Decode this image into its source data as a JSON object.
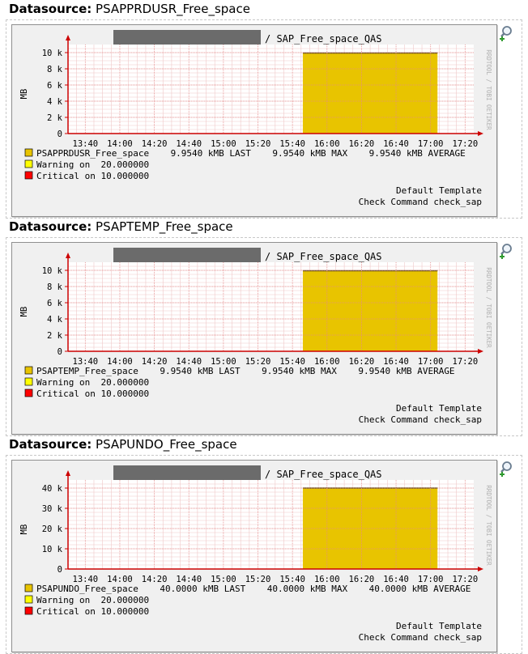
{
  "sections": [
    {
      "heading_label": "Datasource:",
      "name": "PSAPPRDUSR_Free_space",
      "graph_title_suffix": "/ SAP_Free_space_QAS",
      "ylabel": "MB",
      "y_ticks": [
        "0",
        "2 k",
        "4 k",
        "6 k",
        "8 k",
        "10 k"
      ],
      "x_ticks": [
        "13:40",
        "14:00",
        "14:20",
        "14:40",
        "15:00",
        "15:20",
        "15:40",
        "16:00",
        "16:20",
        "16:40",
        "17:00",
        "17:20"
      ],
      "side_text": "RRDTOOL / TOBI OETIKER",
      "legend": [
        {
          "label": "PSAPPRDUSR_Free_space",
          "stats": "9.9540 kMB LAST    9.9540 kMB MAX    9.9540 kMB AVERAGE",
          "color": "#e8c400"
        },
        {
          "label": "Warning on  20.000000",
          "stats": "",
          "color": "#ffff00"
        },
        {
          "label": "Critical on 10.000000",
          "stats": "",
          "color": "#ff0000"
        }
      ],
      "footer": [
        "Default Template",
        "Check Command check_sap"
      ]
    },
    {
      "heading_label": "Datasource:",
      "name": "PSAPTEMP_Free_space",
      "graph_title_suffix": "/ SAP_Free_space_QAS",
      "ylabel": "MB",
      "y_ticks": [
        "0",
        "2 k",
        "4 k",
        "6 k",
        "8 k",
        "10 k"
      ],
      "x_ticks": [
        "13:40",
        "14:00",
        "14:20",
        "14:40",
        "15:00",
        "15:20",
        "15:40",
        "16:00",
        "16:20",
        "16:40",
        "17:00",
        "17:20"
      ],
      "side_text": "RRDTOOL / TOBI OETIKER",
      "legend": [
        {
          "label": "PSAPTEMP_Free_space",
          "stats": "9.9540 kMB LAST    9.9540 kMB MAX    9.9540 kMB AVERAGE",
          "color": "#e8c400"
        },
        {
          "label": "Warning on  20.000000",
          "stats": "",
          "color": "#ffff00"
        },
        {
          "label": "Critical on 10.000000",
          "stats": "",
          "color": "#ff0000"
        }
      ],
      "footer": [
        "Default Template",
        "Check Command check_sap"
      ]
    },
    {
      "heading_label": "Datasource:",
      "name": "PSAPUNDO_Free_space",
      "graph_title_suffix": "/ SAP_Free_space_QAS",
      "ylabel": "MB",
      "y_ticks": [
        "0",
        "10 k",
        "20 k",
        "30 k",
        "40 k"
      ],
      "x_ticks": [
        "13:40",
        "14:00",
        "14:20",
        "14:40",
        "15:00",
        "15:20",
        "15:40",
        "16:00",
        "16:20",
        "16:40",
        "17:00",
        "17:20"
      ],
      "side_text": "RRDTOOL / TOBI OETIKER",
      "legend": [
        {
          "label": "PSAPUNDO_Free_space",
          "stats": "40.0000 kMB LAST    40.0000 kMB MAX    40.0000 kMB AVERAGE",
          "color": "#e8c400"
        },
        {
          "label": "Warning on  20.000000",
          "stats": "",
          "color": "#ffff00"
        },
        {
          "label": "Critical on 10.000000",
          "stats": "",
          "color": "#ff0000"
        }
      ],
      "footer": [
        "Default Template",
        "Check Command check_sap"
      ]
    }
  ],
  "chart_data": [
    {
      "type": "area",
      "title": "/ SAP_Free_space_QAS",
      "ylabel": "MB",
      "ylim": [
        0,
        11000
      ],
      "x_range": [
        "13:30",
        "17:25"
      ],
      "grid": true,
      "series": [
        {
          "name": "PSAPPRDUSR_Free_space",
          "x": [
            "15:46",
            "17:04"
          ],
          "values": [
            9954,
            9954
          ],
          "color": "#e8c400"
        }
      ]
    },
    {
      "type": "area",
      "title": "/ SAP_Free_space_QAS",
      "ylabel": "MB",
      "ylim": [
        0,
        11000
      ],
      "x_range": [
        "13:30",
        "17:25"
      ],
      "grid": true,
      "series": [
        {
          "name": "PSAPTEMP_Free_space",
          "x": [
            "15:46",
            "17:04"
          ],
          "values": [
            9954,
            9954
          ],
          "color": "#e8c400"
        }
      ]
    },
    {
      "type": "area",
      "title": "/ SAP_Free_space_QAS",
      "ylabel": "MB",
      "ylim": [
        0,
        44000
      ],
      "x_range": [
        "13:30",
        "17:25"
      ],
      "grid": true,
      "series": [
        {
          "name": "PSAPUNDO_Free_space",
          "x": [
            "15:46",
            "17:04"
          ],
          "values": [
            40000,
            40000
          ],
          "color": "#e8c400"
        }
      ]
    }
  ]
}
